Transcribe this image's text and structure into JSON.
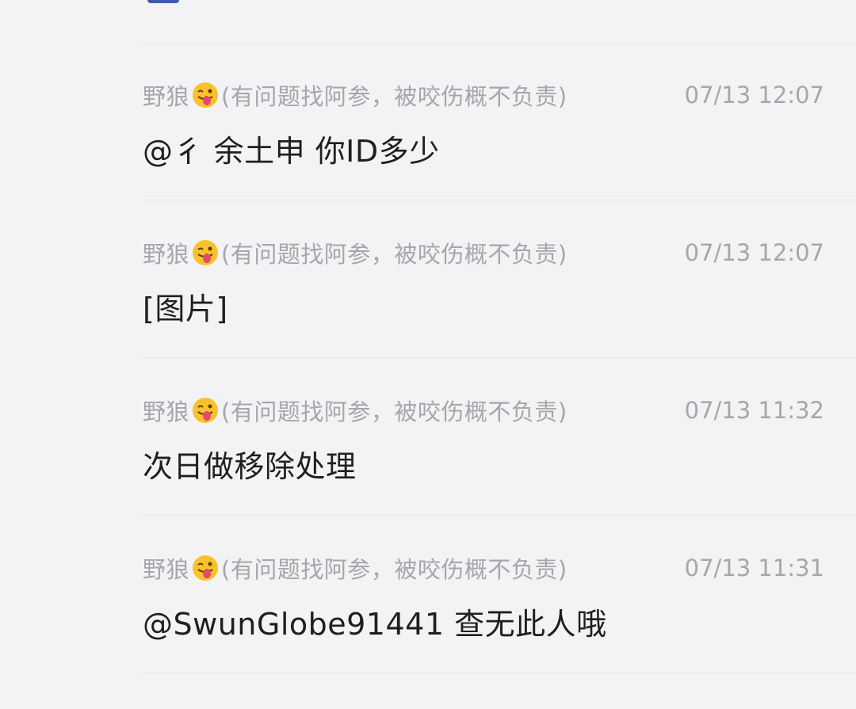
{
  "messages": [
    {
      "sender_name": "野狼",
      "sender_emoji": "winking-face-with-tongue-icon",
      "sender_note": "(有问题找阿参，被咬伤概不负责)",
      "time": "07/13 12:07",
      "text": "@彳 余土申 你ID多少"
    },
    {
      "sender_name": "野狼",
      "sender_emoji": "winking-face-with-tongue-icon",
      "sender_note": "(有问题找阿参，被咬伤概不负责)",
      "time": "07/13 12:07",
      "text": "[图片]"
    },
    {
      "sender_name": "野狼",
      "sender_emoji": "winking-face-with-tongue-icon",
      "sender_note": "(有问题找阿参，被咬伤概不负责)",
      "time": "07/13 11:32",
      "text": "次日做移除处理"
    },
    {
      "sender_name": "野狼",
      "sender_emoji": "winking-face-with-tongue-icon",
      "sender_note": "(有问题找阿参，被咬伤概不负责)",
      "time": "07/13 11:31",
      "text": "@SwunGlobe91441 查无此人哦"
    }
  ],
  "colors": {
    "background": "#f3f3f5",
    "meta_text": "#a6a6ab",
    "body_text": "#1f1f22",
    "divider": "#e6e6ea",
    "emoji_face": "#f9c22b",
    "emoji_tongue": "#e8476d"
  }
}
